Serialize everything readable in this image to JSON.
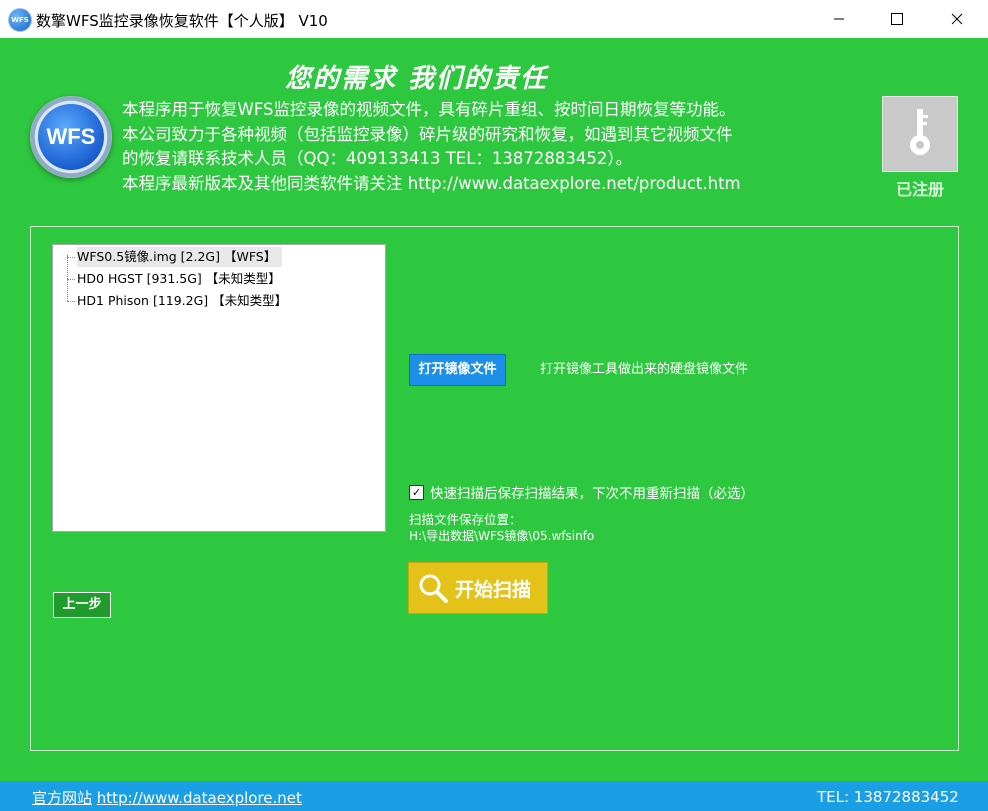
{
  "window": {
    "logo_text": "WFS",
    "title": "数擎WFS监控录像恢复软件【个人版】 V10"
  },
  "header": {
    "motto": "您的需求    我们的责任",
    "logo_text": "WFS",
    "info_lines": [
      "本程序用于恢复WFS监控录像的视频文件，具有碎片重组、按时间日期恢复等功能。",
      "本公司致力于各种视频（包括监控录像）碎片级的研究和恢复，如遇到其它视频文件",
      "的恢复请联系技术人员（QQ：409133413  TEL：13872883452）。",
      "本程序最新版本及其他同类软件请关注 http://www.dataexplore.net/product.htm"
    ],
    "registered_label": "已注册"
  },
  "tree": {
    "items": [
      {
        "label": "WFS0.5镜像.img    [2.2G] 【WFS】"
      },
      {
        "label": "HD0  HGST  [931.5G] 【未知类型】"
      },
      {
        "label": "HD1  Phison  [119.2G] 【未知类型】"
      }
    ]
  },
  "actions": {
    "open_image_label": "打开镜像文件",
    "open_image_desc": "打开镜像工具做出来的硬盘镜像文件",
    "quick_scan_checked": true,
    "quick_scan_label": "快速扫描后保存扫描结果，下次不用重新扫描（必选）",
    "save_location_caption": "扫描文件保存位置：",
    "save_location_path": "H:\\导出数据\\WFS镜像\\05.wfsinfo",
    "start_scan_label": "开始扫描",
    "back_label": "上一步"
  },
  "footer": {
    "site_prefix": "官方网站",
    "site_url": "http://www.dataexplore.net",
    "tel": "TEL: 13872883452"
  },
  "colors": {
    "background": "#2ec840",
    "footer": "#1a9ee6",
    "open_button": "#1e8fe8",
    "scan_button": "#e4c21a",
    "back_button": "#1f9c2c"
  }
}
